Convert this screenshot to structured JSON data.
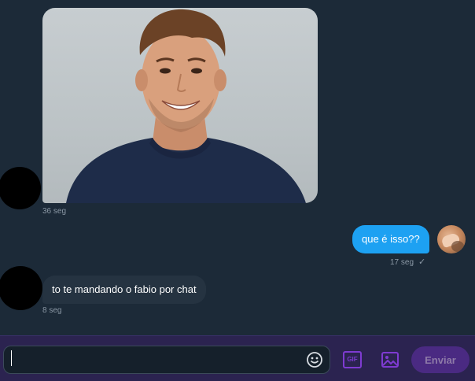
{
  "messages": {
    "photo_time": "36 seg",
    "outgoing_text": "que é isso??",
    "outgoing_time": "17 seg",
    "outgoing_status": "✓",
    "incoming_text": "to te mandando o fabio por chat",
    "incoming_time": "8 seg"
  },
  "composer": {
    "input_value": "",
    "input_placeholder": "",
    "gif_label": "GIF",
    "send_label": "Enviar"
  },
  "icons": {
    "emoji": "smiley-face-icon",
    "gif": "gif-icon",
    "image": "image-icon"
  },
  "colors": {
    "background": "#1c2a38",
    "outgoing_bubble": "#1da1f2",
    "incoming_bubble": "#253341",
    "composer_bar": "#2b2350",
    "accent_purple": "#7e3bd1",
    "send_button": "#4a2a82"
  }
}
